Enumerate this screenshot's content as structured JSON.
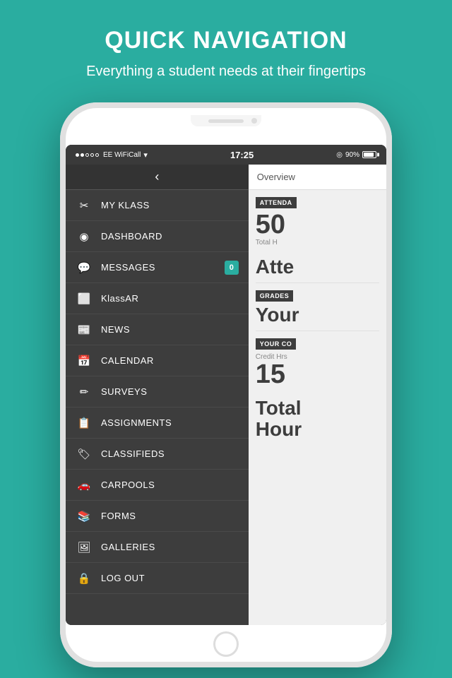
{
  "header": {
    "title": "QUICK NAVIGATION",
    "subtitle": "Everything a student needs at their fingertips"
  },
  "status_bar": {
    "carrier": "●●○○○ EE WiFiCall",
    "wifi": "WiFiCall",
    "time": "17:25",
    "battery": "90%"
  },
  "back_button": "‹",
  "nav_items": [
    {
      "id": "my-klass",
      "icon": "✂",
      "label": "MY KLASS",
      "badge": ""
    },
    {
      "id": "dashboard",
      "icon": "⊙",
      "label": "DASHBOARD",
      "badge": ""
    },
    {
      "id": "messages",
      "icon": "💬",
      "label": "MESSAGES",
      "badge": "0"
    },
    {
      "id": "klassar",
      "icon": "📄",
      "label": "KlassAR",
      "badge": ""
    },
    {
      "id": "news",
      "icon": "📰",
      "label": "NEWS",
      "badge": ""
    },
    {
      "id": "calendar",
      "icon": "📅",
      "label": "CALENDAR",
      "badge": ""
    },
    {
      "id": "surveys",
      "icon": "✏",
      "label": "SURVEYS",
      "badge": ""
    },
    {
      "id": "assignments",
      "icon": "📋",
      "label": "ASSIGNMENTS",
      "badge": ""
    },
    {
      "id": "classifieds",
      "icon": "🏷",
      "label": "CLASSIFIEDS",
      "badge": ""
    },
    {
      "id": "carpools",
      "icon": "🚗",
      "label": "CARPOOLS",
      "badge": ""
    },
    {
      "id": "forms",
      "icon": "📚",
      "label": "FORMS",
      "badge": ""
    },
    {
      "id": "galleries",
      "icon": "🖼",
      "label": "GALLERIES",
      "badge": ""
    },
    {
      "id": "logout",
      "icon": "🔒",
      "label": "LOG OUT",
      "badge": ""
    }
  ],
  "right_panel": {
    "overview_label": "Overview",
    "attendance_badge": "ATTENDA",
    "attendance_number": "50",
    "attendance_sublabel": "Total H",
    "attendance_text": "Atte",
    "grades_badge": "GRADES",
    "grades_text": "Your",
    "courses_badge": "YOUR CO",
    "credit_label": "Credit Hrs",
    "credit_number": "15",
    "total_label": "Total",
    "hour_label": "Hour"
  }
}
